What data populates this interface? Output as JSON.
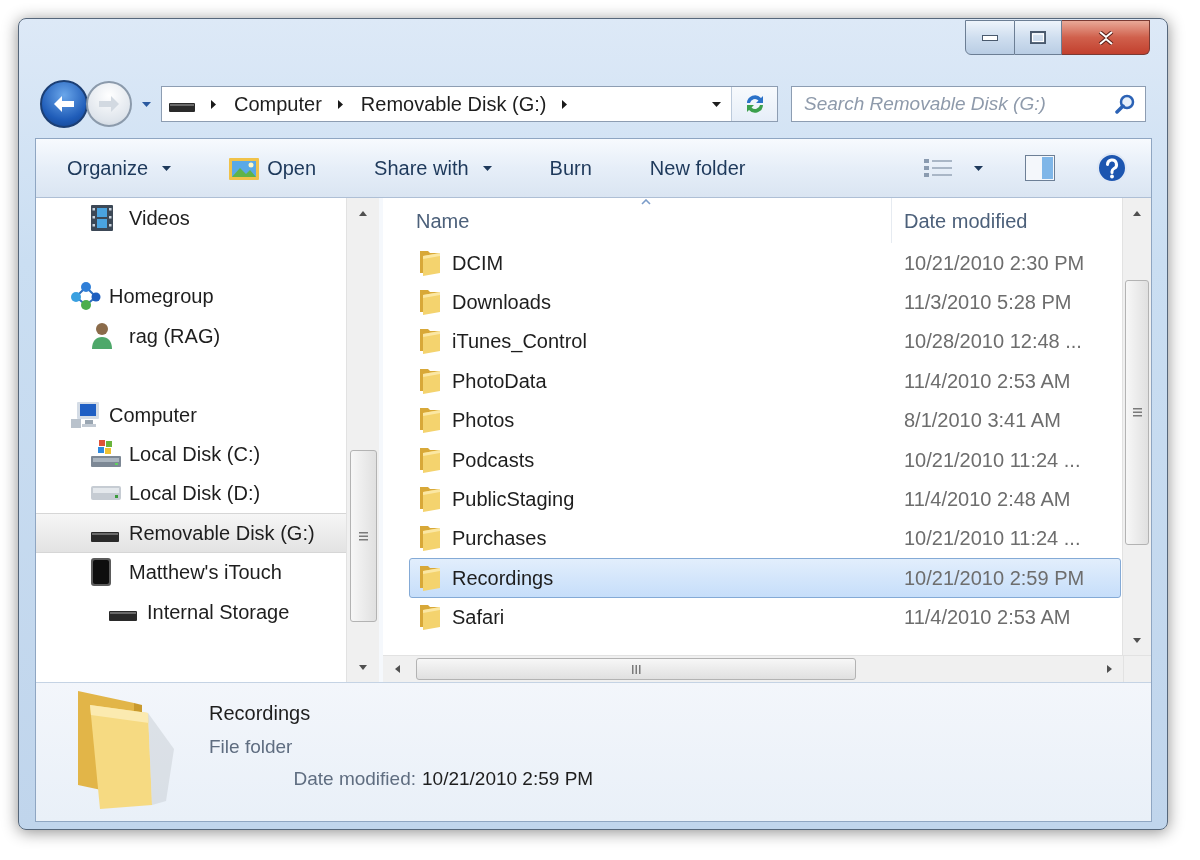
{
  "navigation": {
    "back": {
      "disabled": false
    },
    "forward": {
      "disabled": true
    }
  },
  "address_bar": {
    "segments": [
      "Computer",
      "Removable Disk (G:)"
    ]
  },
  "search": {
    "placeholder": "Search Removable Disk (G:)"
  },
  "toolbar": {
    "buttons": [
      {
        "label": "Organize",
        "kind": "menu"
      },
      {
        "label": "Open",
        "kind": "icon"
      },
      {
        "label": "Share with",
        "kind": "menu"
      },
      {
        "label": "Burn",
        "kind": "plain"
      },
      {
        "label": "New folder",
        "kind": "plain"
      }
    ]
  },
  "navigation_pane": {
    "items": [
      {
        "children": [
          {
            "label": "Videos",
            "kind": "videos",
            "selected": false
          }
        ]
      },
      {
        "label": "Homegroup",
        "kind": "homegroup",
        "selected": false,
        "children": [
          {
            "label": "rag (RAG)",
            "kind": "user",
            "selected": false
          }
        ]
      },
      {
        "label": "Computer",
        "kind": "computer",
        "selected": false,
        "children": [
          {
            "label": "Local Disk (C:)",
            "kind": "system-drive",
            "selected": false
          },
          {
            "label": "Local Disk (D:)",
            "kind": "drive",
            "selected": false
          },
          {
            "label": "Removable Disk (G:)",
            "kind": "removable",
            "selected": true
          },
          {
            "label": "Matthew's iTouch",
            "kind": "device",
            "selected": false,
            "children": [
              {
                "label": "Internal Storage",
                "kind": "removable",
                "selected": false
              }
            ]
          }
        ]
      }
    ]
  },
  "file_list": {
    "columns": [
      {
        "label": "Name",
        "sorted": true
      },
      {
        "label": "Date modified",
        "sorted": false
      }
    ],
    "rows": [
      {
        "name": "DCIM",
        "date_modified": "10/21/2010 2:30 PM",
        "selected": false
      },
      {
        "name": "Downloads",
        "date_modified": "11/3/2010 5:28 PM",
        "selected": false
      },
      {
        "name": "iTunes_Control",
        "date_modified": "10/28/2010 12:48 ...",
        "selected": false
      },
      {
        "name": "PhotoData",
        "date_modified": "11/4/2010 2:53 AM",
        "selected": false
      },
      {
        "name": "Photos",
        "date_modified": "8/1/2010 3:41 AM",
        "selected": false
      },
      {
        "name": "Podcasts",
        "date_modified": "10/21/2010 11:24 ...",
        "selected": false
      },
      {
        "name": "PublicStaging",
        "date_modified": "11/4/2010 2:48 AM",
        "selected": false
      },
      {
        "name": "Purchases",
        "date_modified": "10/21/2010 11:24 ...",
        "selected": false
      },
      {
        "name": "Recordings",
        "date_modified": "10/21/2010 2:59 PM",
        "selected": true
      },
      {
        "name": "Safari",
        "date_modified": "11/4/2010 2:53 AM",
        "selected": false
      }
    ]
  },
  "details_pane": {
    "title": "Recordings",
    "type": "File folder",
    "fields": [
      {
        "label": "Date modified:",
        "value": "10/21/2010 2:59 PM"
      }
    ]
  }
}
